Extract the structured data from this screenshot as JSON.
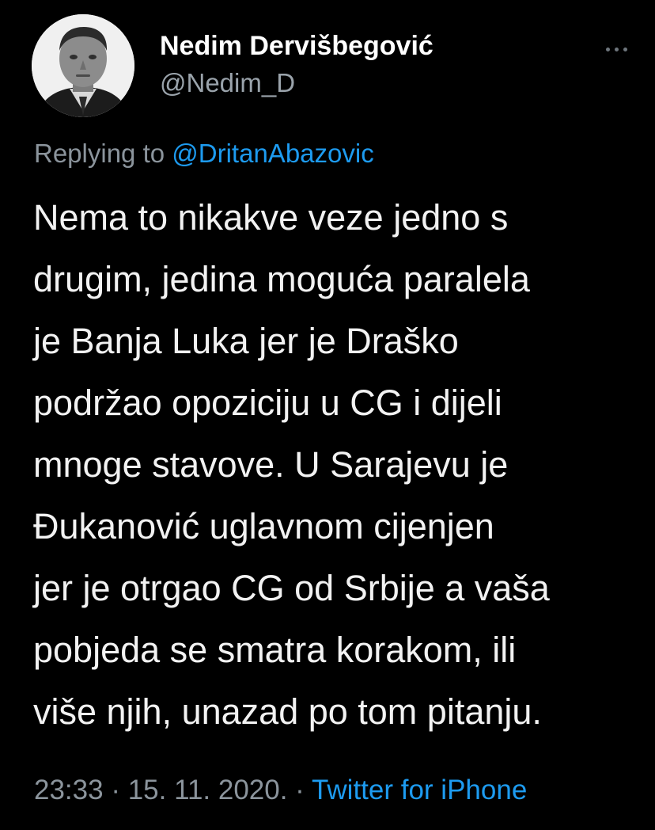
{
  "author": {
    "display_name": "Nedim Dervišbegović",
    "handle": "@Nedim_D",
    "avatar_icon": "profile-photo"
  },
  "more_icon": "ellipsis-icon",
  "reply": {
    "prefix": "Replying to",
    "mention": "@DritanAbazovic"
  },
  "text_lines": [
    "Nema to nikakve veze jedno s",
    "drugim, jedina moguća paralela",
    "je Banja Luka jer je Draško",
    "podržao opoziciju u CG i dijeli",
    "mnoge stavove. U Sarajevu je",
    "Đukanović uglavnom cijenjen",
    "jer je otrgao CG od Srbije a vaša",
    "pobjeda se smatra korakom, ili",
    "više njih, unazad po tom pitanju."
  ],
  "meta": {
    "time": "23:33",
    "separator": " · ",
    "date": "15. 11. 2020.",
    "source": "Twitter for iPhone"
  },
  "colors": {
    "background": "#000000",
    "accent": "#1d9bf0",
    "secondary_text": "#8b949c",
    "primary_text": "#f2f2f2"
  }
}
